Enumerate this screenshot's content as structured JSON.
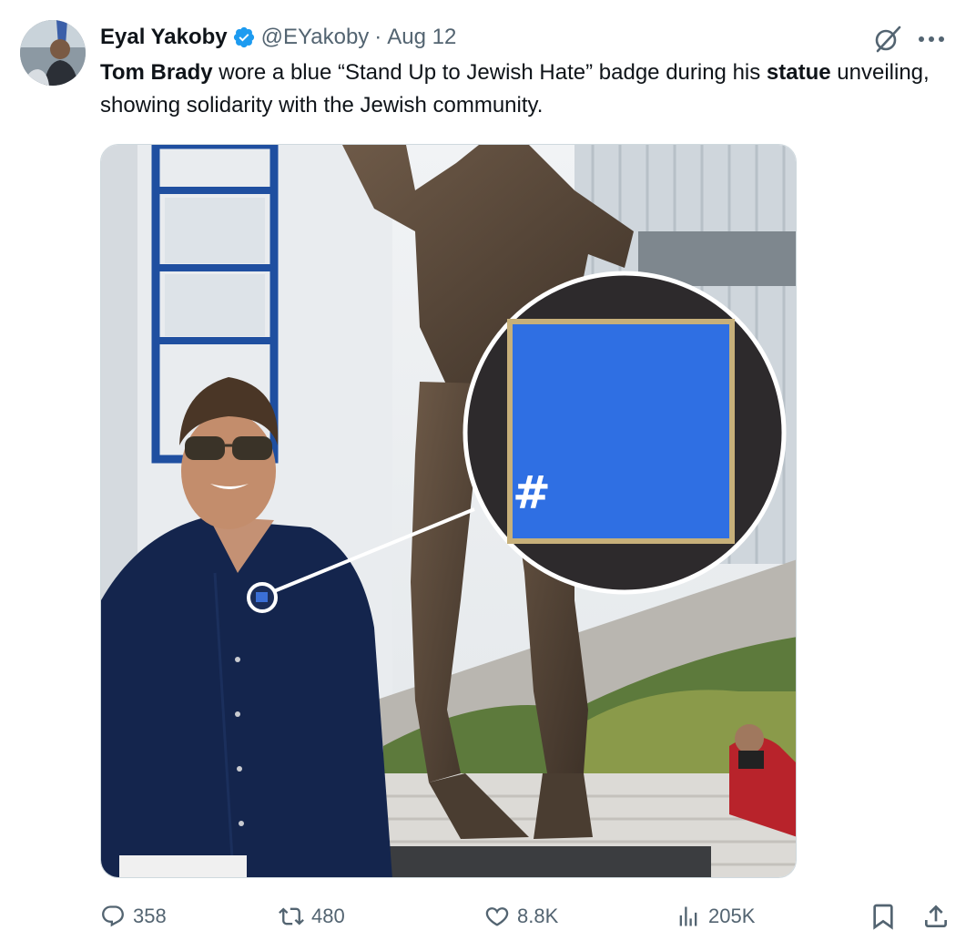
{
  "tweet": {
    "author_name": "Eyal Yakoby",
    "handle": "@EYakoby",
    "separator": "·",
    "date": "Aug 12",
    "text_parts": [
      {
        "text": "Tom Brady",
        "bold": true
      },
      {
        "text": " wore a blue “Stand Up to Jewish Hate” badge during his ",
        "bold": false
      },
      {
        "text": "statue",
        "bold": true
      },
      {
        "text": " unveiling, showing solidarity with the Jewish community.",
        "bold": false
      }
    ],
    "badge_symbol": "#"
  },
  "metrics": {
    "replies": "358",
    "reposts": "480",
    "likes": "8.8K",
    "views": "205K"
  },
  "icons": {
    "verified": "verified-badge-icon",
    "grok": "grok-icon",
    "more": "more-icon",
    "reply": "reply-icon",
    "repost": "repost-icon",
    "like": "heart-icon",
    "views": "views-chart-icon",
    "bookmark": "bookmark-icon",
    "share": "share-icon"
  },
  "colors": {
    "text": "#0f1419",
    "secondary": "#536471",
    "verified_blue": "#1d9bf0",
    "badge_blue": "#2f6fe3"
  }
}
